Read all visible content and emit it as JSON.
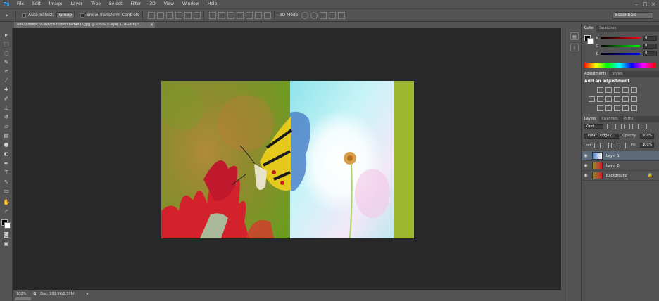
{
  "app": {
    "logo": "Ps"
  },
  "menu": [
    "File",
    "Edit",
    "Image",
    "Layer",
    "Type",
    "Select",
    "Filter",
    "3D",
    "View",
    "Window",
    "Help"
  ],
  "window_controls": [
    "–",
    "□",
    "×"
  ],
  "options": {
    "auto_select_label": "Auto-Select:",
    "auto_select_value": "Group",
    "show_transform_label": "Show Transform Controls",
    "mode_3d_label": "3D Mode:",
    "workspace": "Essentials"
  },
  "document": {
    "tab_title": "a8e1c8be9c0530f7c82cc8f7f1ad4a35.jpg @ 100% (Layer 1, RGB/8) *",
    "close": "×"
  },
  "status": {
    "zoom": "100%",
    "doc_info": "Doc: 991.9K/2.53M"
  },
  "panels": {
    "color": {
      "tabs": [
        "Color",
        "Swatches"
      ],
      "rows": [
        {
          "label": "R",
          "value": "0"
        },
        {
          "label": "G",
          "value": "0"
        },
        {
          "label": "B",
          "value": "0"
        }
      ]
    },
    "adjustments": {
      "tabs": [
        "Adjustments",
        "Styles"
      ],
      "heading": "Add an adjustment"
    },
    "layers": {
      "tabs": [
        "Layers",
        "Channels",
        "Paths"
      ],
      "filter_kind": "Kind",
      "blend_mode": "Linear Dodge (...",
      "opacity_label": "Opacity:",
      "opacity_value": "100%",
      "lock_label": "Lock:",
      "fill_label": "Fill:",
      "fill_value": "100%",
      "items": [
        {
          "name": "Layer 1",
          "selected": true
        },
        {
          "name": "Layer 0",
          "selected": false
        },
        {
          "name": "Background",
          "selected": false
        }
      ]
    }
  },
  "colors": {
    "accent": "#31a8ff",
    "canvas_bg": "#282828",
    "ui_bg": "#535353",
    "selection": "#5d6a7a"
  }
}
